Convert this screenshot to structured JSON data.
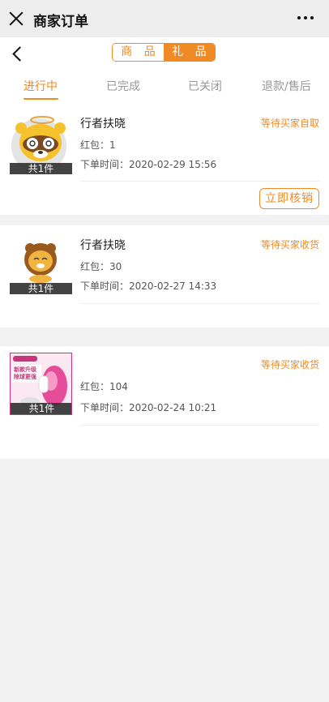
{
  "window": {
    "title": "商家订单"
  },
  "segmented": {
    "goods_label": "商 品",
    "gifts_label": "礼 品"
  },
  "tabs": [
    {
      "label": "进行中"
    },
    {
      "label": "已完成"
    },
    {
      "label": "已关闭"
    },
    {
      "label": "退款/售后"
    }
  ],
  "orders": [
    {
      "name": "行者扶晓",
      "status": "等待买家自取",
      "count_badge": "共1件",
      "redpacket": "红包：1",
      "order_time": "下单时间：2020-02-29 15:56",
      "action_label": "立即核销",
      "image_icon": "raccoon-mascot"
    },
    {
      "name": "行者扶晓",
      "status": "等待买家收货",
      "count_badge": "共1件",
      "redpacket": "红包：30",
      "order_time": "下单时间：2020-02-27 14:33",
      "image_icon": "lion-mascot"
    },
    {
      "name": "",
      "status": "等待买家收货",
      "count_badge": "共1件",
      "redpacket": "红包：104",
      "order_time": "下单时间：2020-02-24 10:21",
      "image_icon": "lint-remover-product",
      "image_text": {
        "banner": "新款升级",
        "subline": "除球更强"
      }
    }
  ],
  "colors": {
    "accent": "#f08a24",
    "background": "#f2f2f2",
    "topbar": "#ededed"
  }
}
